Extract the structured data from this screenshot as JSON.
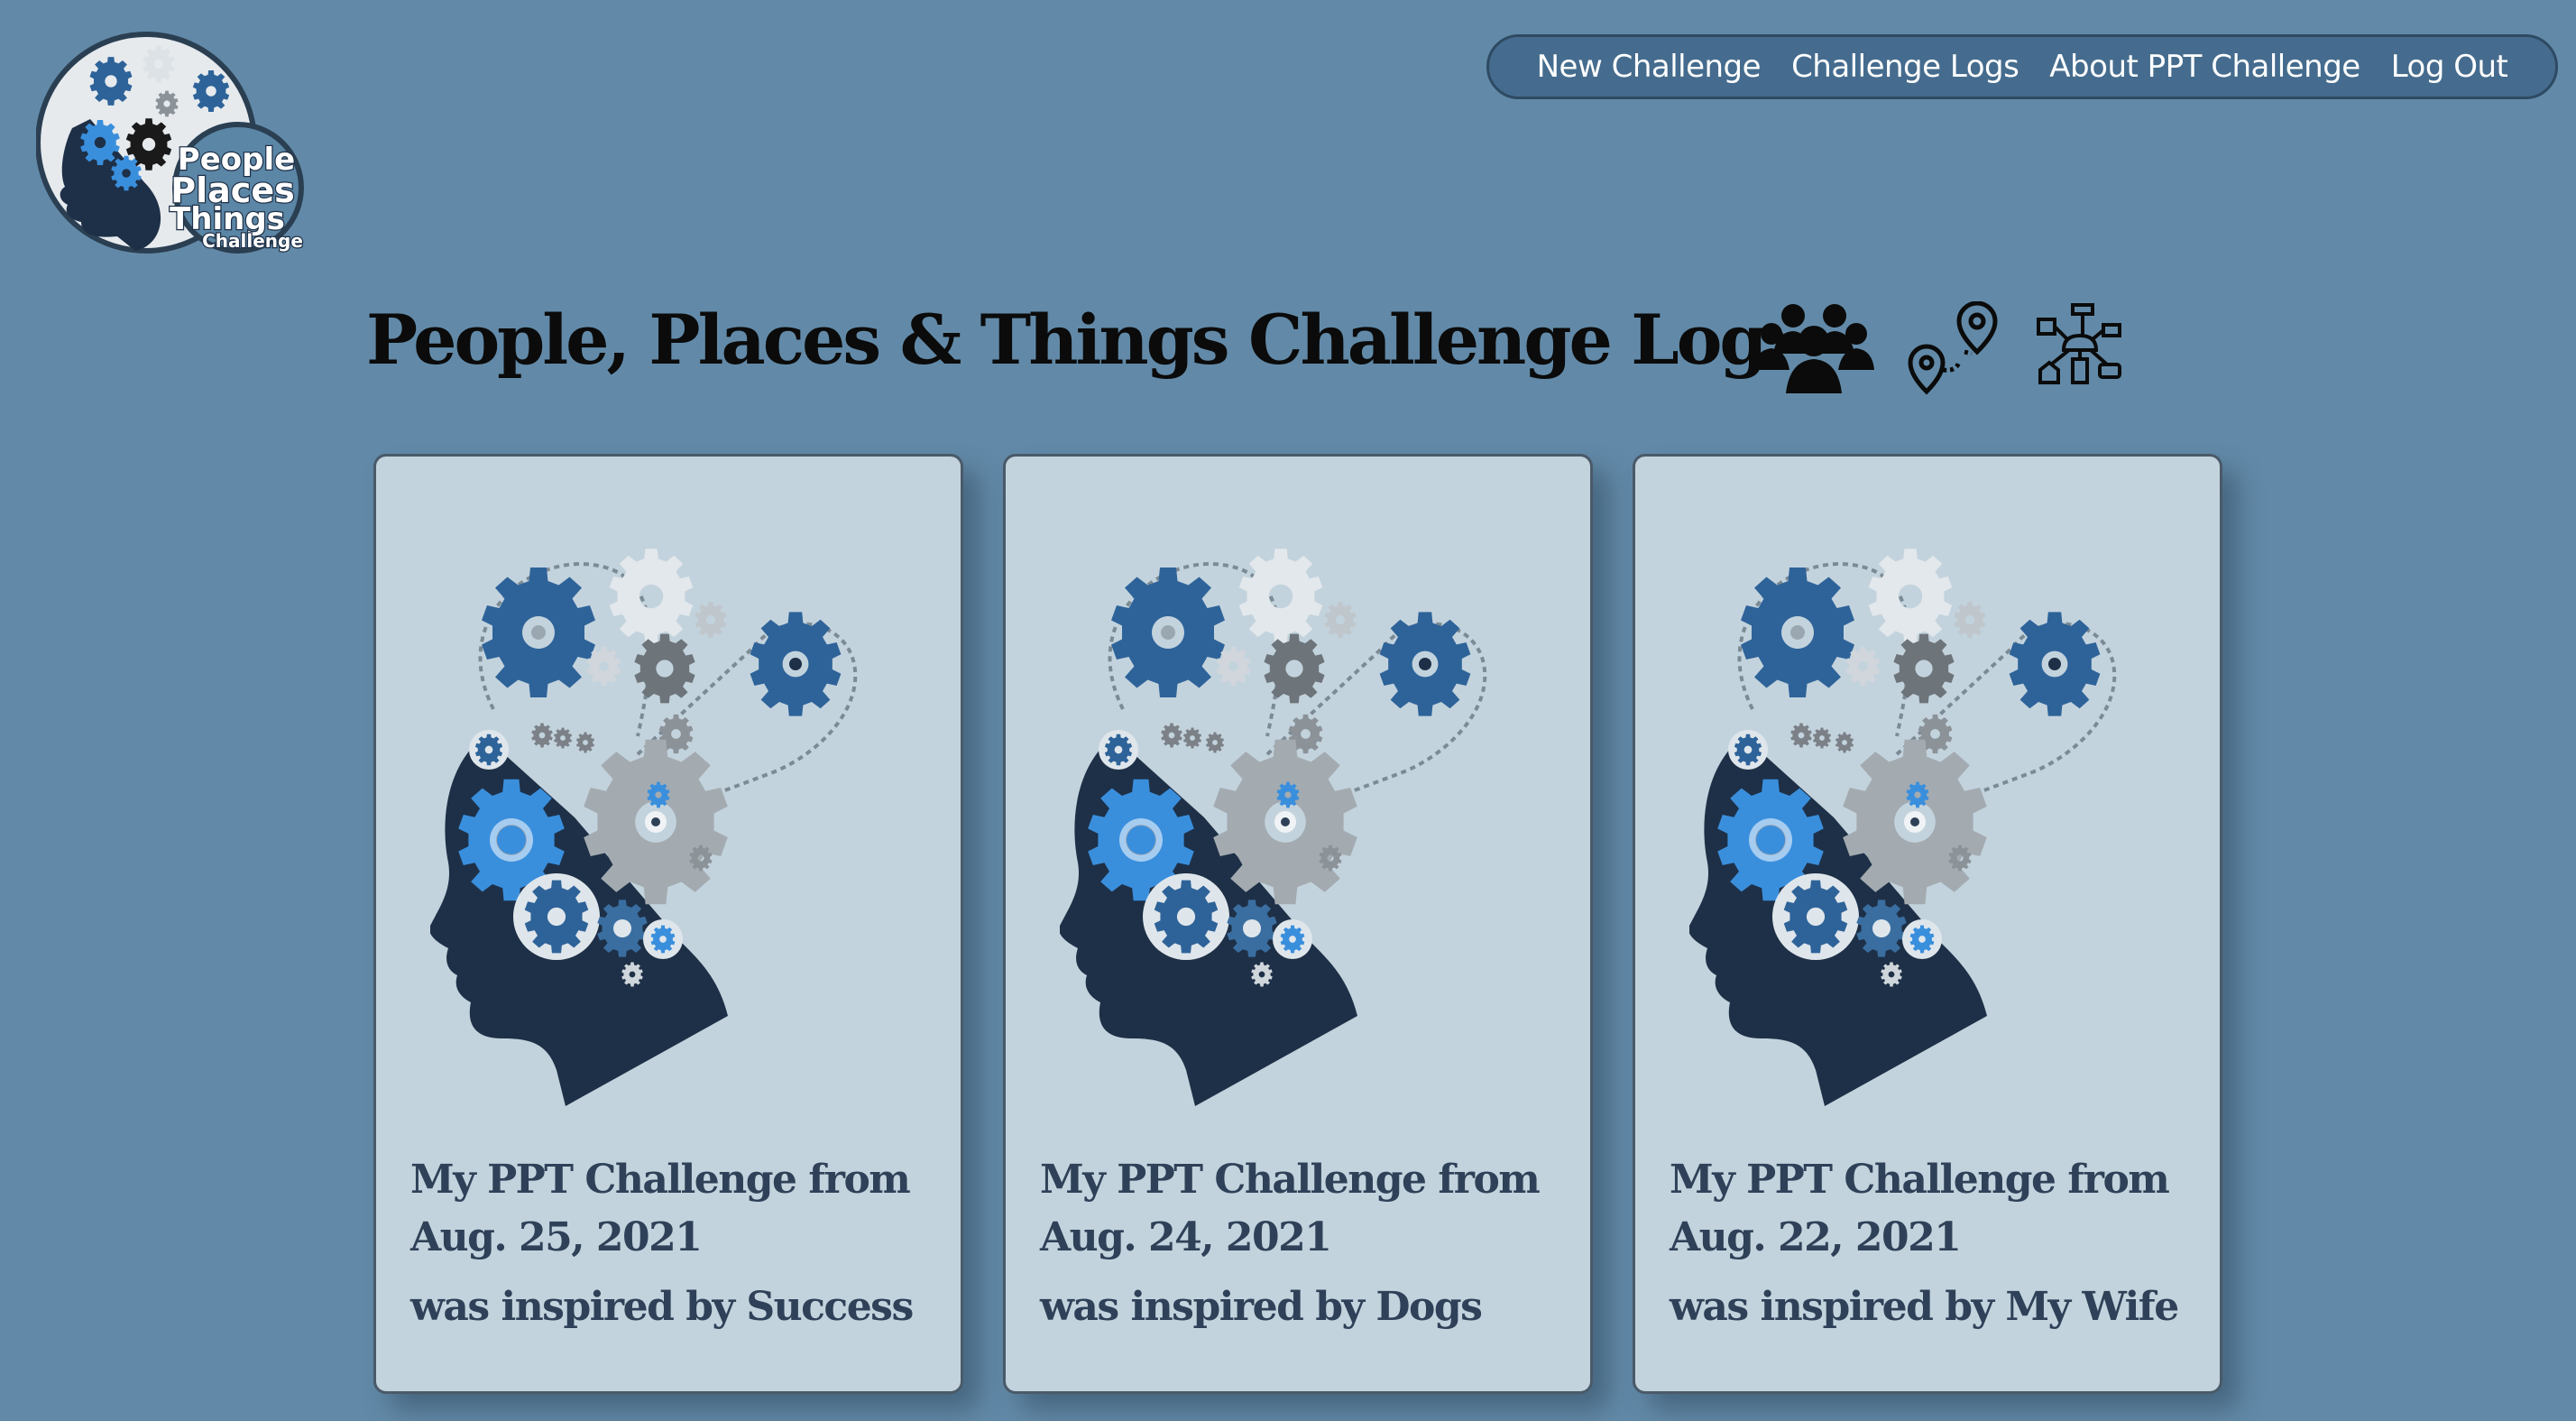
{
  "logo": {
    "text_line1": "People",
    "text_line2": "Places",
    "text_line3": "Things",
    "text_line4": "Challenge"
  },
  "nav": {
    "items": [
      {
        "label": "New Challenge"
      },
      {
        "label": "Challenge Logs"
      },
      {
        "label": "About PPT Challenge"
      },
      {
        "label": "Log Out"
      }
    ]
  },
  "header": {
    "title": "People, Places & Things Challenge Log:",
    "icons": [
      "people-icon",
      "map-pins-icon",
      "things-network-icon"
    ]
  },
  "cards": [
    {
      "title_line1": "My PPT Challenge from",
      "title_line2": "Aug. 25, 2021",
      "inspired": "was inspired by Success",
      "image_icon": "gear-head-icon"
    },
    {
      "title_line1": "My PPT Challenge from",
      "title_line2": "Aug. 24, 2021",
      "inspired": "was inspired by Dogs",
      "image_icon": "gear-head-icon"
    },
    {
      "title_line1": "My PPT Challenge from",
      "title_line2": "Aug. 22, 2021",
      "inspired": "was inspired by My Wife",
      "image_icon": "gear-head-icon"
    }
  ],
  "colors": {
    "background": "#628aa8",
    "nav_background": "#456c8e",
    "card_background": "#c3d3dd",
    "card_text": "#2e4158",
    "head_silhouette": "#1e3047"
  }
}
